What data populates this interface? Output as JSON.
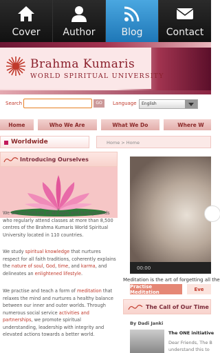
{
  "tabs": [
    {
      "label": "Cover",
      "icon": "home-icon"
    },
    {
      "label": "Author",
      "icon": "person-icon"
    },
    {
      "label": "Blog",
      "icon": "rss-icon",
      "active": true
    },
    {
      "label": "Contact",
      "icon": "mail-icon"
    }
  ],
  "banner": {
    "title": "Brahma Kumaris",
    "subtitle": "WORLD SPIRITUAL UNIVERSITY"
  },
  "search": {
    "label": "Search",
    "value": "",
    "go_label": "GO",
    "language_label": "Language",
    "language_value": "English"
  },
  "nav": [
    "Home",
    "Who We Are",
    "What We Do",
    "Where W"
  ],
  "section": {
    "title": "Worldwide",
    "breadcrumb": "Home > Home"
  },
  "intro": {
    "title": "Introducing Ourselves",
    "p1": "We are individuals of all ages and backgrounds who regularly attend classes at more than 8,500 centres of the Brahma Kumaris World Spiritual University located in 110 countries.",
    "p2_a": "We study ",
    "p2_link1": "spiritual knowledge",
    "p2_b": " that nurtures respect for all faith traditions, coherently explains the ",
    "p2_link2": "nature of soul",
    "p2_c": ", ",
    "p2_link3": "God",
    "p2_d": ", ",
    "p2_link4": "time",
    "p2_e": ", and ",
    "p2_link5": "karma",
    "p2_f": ", and delineates an ",
    "p2_link6": "enlightened lifestyle",
    "p2_g": ".",
    "p3_a": "We practise and teach a form of ",
    "p3_link1": "meditation",
    "p3_b": " that relaxes the mind and nurtures a healthy balance between our inner and outer worlds. Through numerous social service ",
    "p3_link2": "activities and partnerships",
    "p3_c": ", we promote spiritual understanding, leadership with integrity and elevated actions towards a better world."
  },
  "video": {
    "time": "00:00",
    "caption": "Meditation is the art of forgetting all the"
  },
  "media_tabs": [
    "Practise Meditation",
    "Eve"
  ],
  "call": {
    "title": "The Call of Our Time",
    "author": "By Dadi Janki",
    "headline_bold": "The ONE initiative",
    "headline_rest": " ",
    "body1": "Dear Friends, The B",
    "body2": "understand this to"
  }
}
